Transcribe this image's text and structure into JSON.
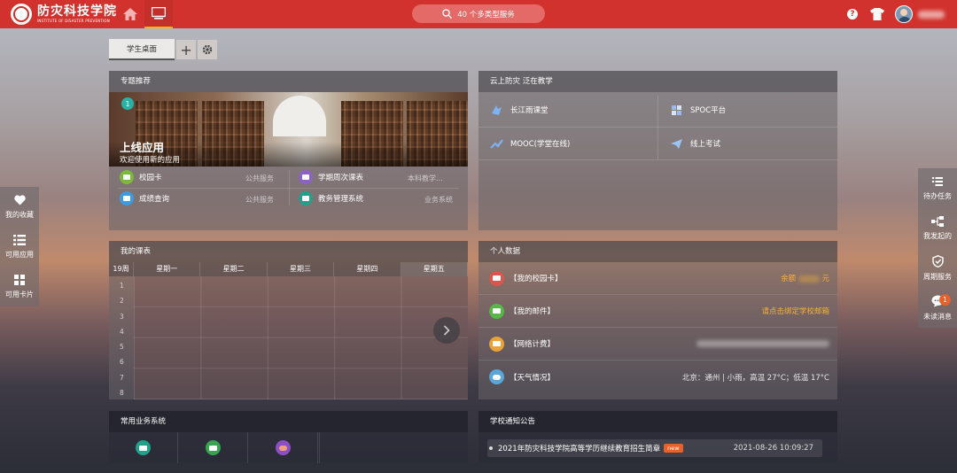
{
  "header": {
    "logo_text": "防灾科技学院",
    "logo_subtext": "INSTITUTE OF DISASTER PREVENTION",
    "search_label": "40 个多类型服务"
  },
  "desktop_tabs": {
    "active_tab": "学生桌面",
    "add_symbol": "+"
  },
  "featured": {
    "title": "专题推荐",
    "badge": "1",
    "banner_title": "上线应用",
    "banner_subtitle": "欢迎使用新的应用",
    "apps": [
      {
        "name": "校园卡",
        "tag": "公共服务",
        "color": "#7dba3a"
      },
      {
        "name": "学期周次课表",
        "tag": "本科教学...",
        "color": "#8c62c8"
      },
      {
        "name": "成绩查询",
        "tag": "公共服务",
        "color": "#3d9be0"
      },
      {
        "name": "教务管理系统",
        "tag": "业务系统",
        "color": "#22a08a"
      }
    ]
  },
  "cloud": {
    "title": "云上防灾 泛在教学",
    "items": [
      "长江雨课堂",
      "SPOC平台",
      "MOOC(学堂在线)",
      "线上考试"
    ]
  },
  "schedule": {
    "title": "我的课表",
    "week_label": "19周",
    "days": [
      "星期一",
      "星期二",
      "星期三",
      "星期四",
      "星期五"
    ],
    "periods": [
      "1",
      "2",
      "3",
      "4",
      "5",
      "6",
      "7",
      "8"
    ]
  },
  "personal": {
    "title": "个人数据",
    "rows": [
      {
        "label": "【我的校园卡】",
        "value_prefix": "余额",
        "value_suffix": "元",
        "color": "#d8564d"
      },
      {
        "label": "【我的邮件】",
        "value": "请点击绑定学校邮箱",
        "color": "#57b848"
      },
      {
        "label": "【网络计费】",
        "value": "",
        "color": "#e9a23a"
      },
      {
        "label": "【天气情况】",
        "value": "北京：通州  |  小雨，高温 27°C；低温 17°C",
        "color": "#5aa6d8"
      }
    ]
  },
  "business": {
    "title": "常用业务系统",
    "colors": [
      "#22a08a",
      "#3aa352",
      "#8c4fc4"
    ]
  },
  "notices": {
    "title": "学校通知公告",
    "items": [
      {
        "text": "2021年防灾科技学院高等学历继续教育招生简章",
        "badge": "new",
        "date": "2021-08-26 10:09:27"
      }
    ]
  },
  "left_dock": {
    "items": [
      "我的收藏",
      "可用应用",
      "可用卡片"
    ]
  },
  "right_dock": {
    "items": [
      "待办任务",
      "我发起的",
      "周期服务",
      "未读消息"
    ],
    "unread_count": "1"
  },
  "colors": {
    "topbar": "#d2322d",
    "accent": "#e8602a",
    "highlight_text": "#f3b23a"
  }
}
